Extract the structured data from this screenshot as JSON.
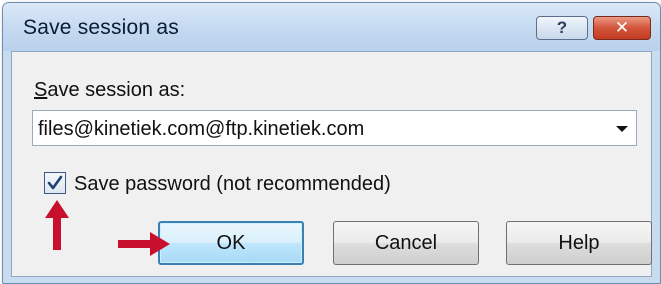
{
  "window": {
    "title": "Save session as"
  },
  "titlebar_buttons": {
    "help_glyph": "?",
    "close_glyph": "✕"
  },
  "form": {
    "label_first_letter": "S",
    "label_rest": "ave session as:",
    "session_value": "files@kinetiek.com@ftp.kinetiek.com",
    "save_password_label": "Save password (not recommended)",
    "save_password_checked": true
  },
  "buttons": {
    "ok": "OK",
    "cancel": "Cancel",
    "help": "Help"
  },
  "colors": {
    "annotation_arrow": "#c8102e",
    "default_button_border": "#3c7fb1"
  },
  "icons": {
    "checkbox_check": "check-icon",
    "dropdown": "chevron-down-icon",
    "annotation": "red-arrow-icon"
  }
}
